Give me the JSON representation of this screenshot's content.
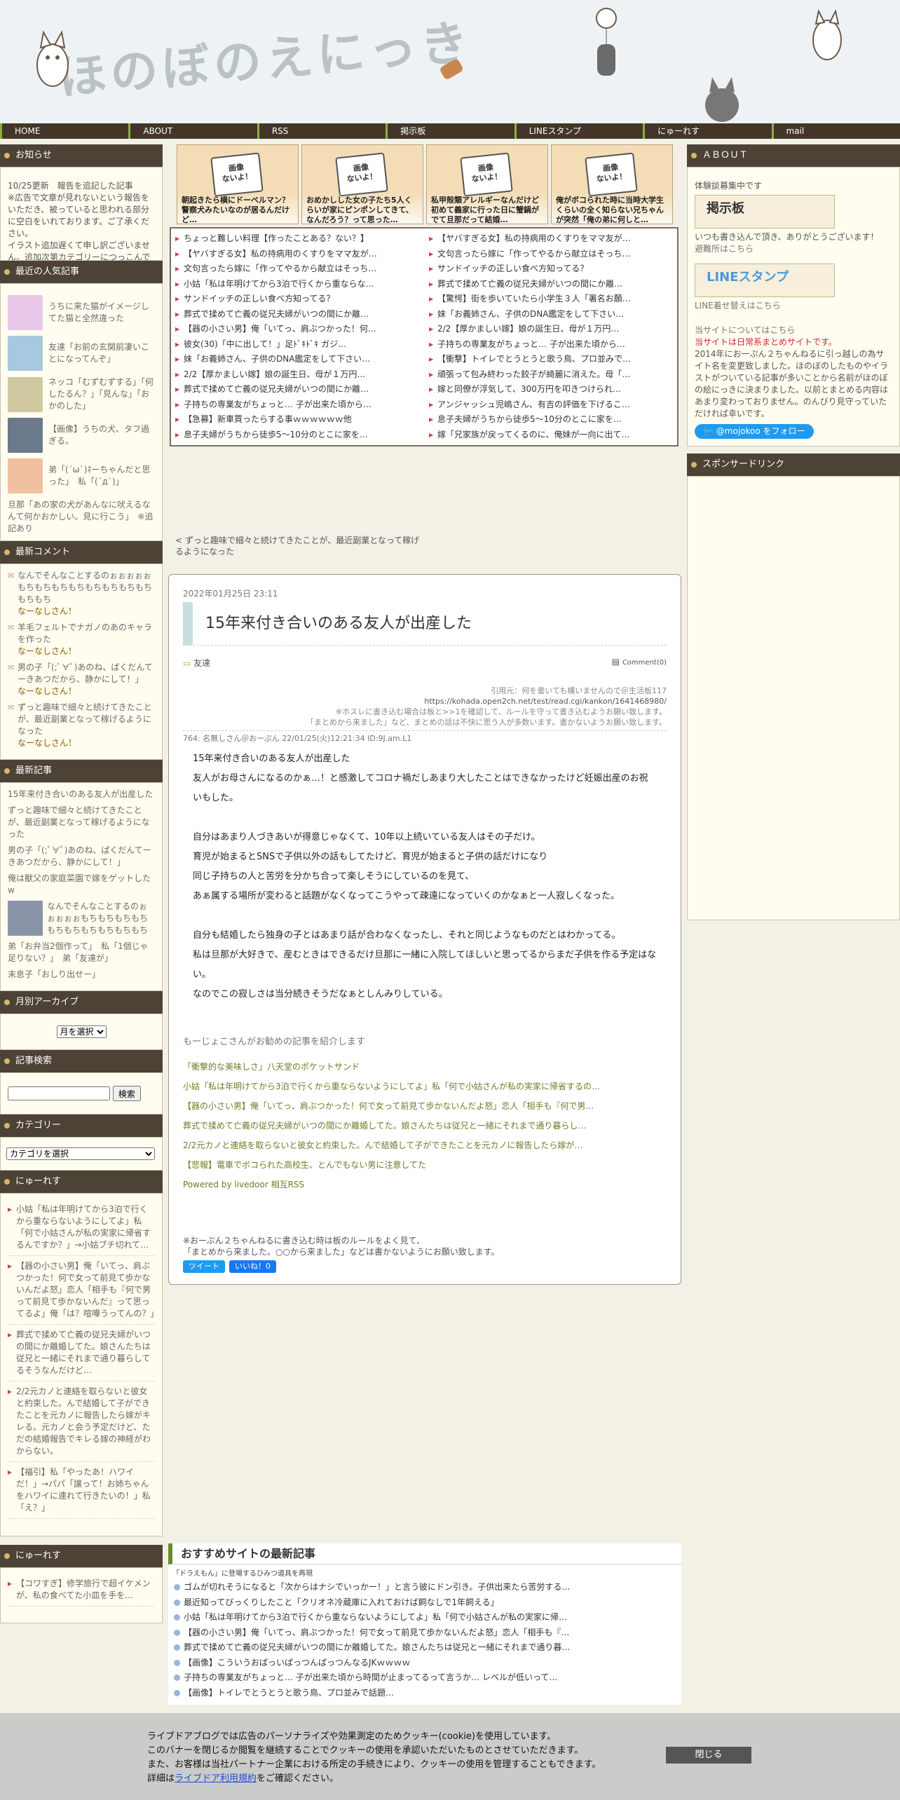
{
  "site": {
    "title": "ほのぼのえにっき"
  },
  "nav": [
    "HOME",
    "ABOUT",
    "RSS",
    "掲示板",
    "LINEスタンプ",
    "にゅーれす",
    "mail"
  ],
  "left": {
    "notice": {
      "title": "お知らせ",
      "body": "10/25更新　報告を追記した記事\n※広告で文章が見れないという報告をいただき、被っていると思われる部分に空白をいれております。ご了承ください。\nイラスト追加遅くて申し訳ございません。追加次第カテゴリーにつっこんでます。"
    },
    "popular": {
      "title": "最近の人気記事",
      "items": [
        {
          "text": "うちに来た猫がイメージしてた猫と全然違った",
          "color": "#e8c8e8"
        },
        {
          "text": "友達「お前の玄関前凄いことになってんぞ」",
          "color": "#a8c8e0"
        },
        {
          "text": "ネッコ「むずむずする」「何したるん？」「見んな」「おかのした」",
          "color": "#d0c8a0"
        },
        {
          "text": "【画像】うちの犬、タフ過ぎる。",
          "color": "#6a7a8a"
        },
        {
          "text": "弟「(´ω`)ﾈーちゃんだと思った」　私「(´д`)」",
          "color": "#f0c0a0"
        }
      ],
      "note": "旦那「あの家の犬があんなに吠えるなんて何かおかしい。見に行こう」　※追記あり"
    },
    "comments": {
      "title": "最新コメント",
      "items": [
        {
          "title": "なんでそんなことするのぉぉぉぉぉもちもちもちもちもちもちもちもちもちもち",
          "author": "なーなしさん！"
        },
        {
          "title": "羊毛フェルトでナガノのあのキャラを作った",
          "author": "なーなしさん！"
        },
        {
          "title": "男の子「(;ﾟ∀ﾟ)あのね、ぱくだんてーきあつだから、静かにして！」",
          "author": "なーなしさん！"
        },
        {
          "title": "ずっと趣味で細々と続けてきたことが、最近副業となって稼げるようになった",
          "author": "なーなしさん！"
        }
      ]
    },
    "recent": {
      "title": "最新記事",
      "items": [
        "15年来付き合いのある友人が出産した",
        "ずっと趣味で細々と続けてきたことが、最近副業となって稼げるようになった",
        "男の子「(;ﾟ∀ﾟ)あのね、ぱくだんてーきあつだから、静かにして！」",
        "俺は獣父の家庭菜園で嫁をゲットしたw",
        "なんでそんなことするのぉぉぉぉぉもちもちもちもちもちもちもちもちもちもち",
        "弟「お弁当2個作って」　私「1個じゃ足りない？」　弟「友達が」",
        "末息子「おしり出せー」"
      ]
    },
    "archive": {
      "title": "月別アーカイブ",
      "select": "月を選択"
    },
    "search": {
      "title": "記事検索",
      "button": "検索",
      "placeholder": ""
    },
    "category": {
      "title": "カテゴリー",
      "select": "カテゴリを選択"
    },
    "news1": {
      "title": "にゅーれす",
      "items": [
        "小姑「私は年明けてから3泊で行くから重ならないようにしてよ」私「何で小姑さんが私の実家に帰省するんですか？」→小姑ブチ切れて…",
        "【器の小さい男】俺「いてっ、肩ぶつかった！何で女って前見て歩かないんだよ怒」恋人「相手も『何で男って前見て歩かないんだ』って思ってるよ」俺「は？喧嘩うってんの？」",
        "葬式で揉めて亡義の従兄夫婦がいつの間にか離婚してた。娘さんたちは従兄と一緒にそれまで通り暮らしてるそうなんだけど…",
        "2/2元カノと連絡を取らないと彼女と約束した。んで結婚して子ができたことを元カノに報告したら嫁がキレる。元カノと会う予定だけど、ただの結婚報告でキレる嫁の神経がわからない。",
        "【福引】私「やったあ！ハワイだ！」→パパ「譲って！お姉ちゃんをハワイに連れて行きたいの！」私「え？」"
      ]
    },
    "news2": {
      "title": "にゅーれす",
      "items": [
        "【コワすぎ】修学旅行で超イケメンが、私の食べてた小皿を手を…"
      ]
    }
  },
  "center": {
    "thumbs": [
      {
        "cap": "朝起きたら横にドーベルマン？警察犬みたいなのが居るんだけど…",
        "noimg": "画像\nないよ！"
      },
      {
        "cap": "おめかしした女の子たち5人くらいが家にピンポンしてきて、なんだろう？って思った…",
        "noimg": "画像\nないよ！"
      },
      {
        "cap": "私甲殻類アレルギーなんだけど初めて義家に行った日に蟹鍋がでて旦那だって結婚…",
        "noimg": "画像\nないよ！"
      },
      {
        "cap": "俺がボコられた時に当時大学生くらいの全く知らない兄ちゃんが突然「俺の弟に何しと…",
        "noimg": "画像\nないよ！"
      }
    ],
    "rss_left": [
      "ちょっと難しい料理【作ったことある？ない？】",
      "【ヤバすぎる女】私の持病用のくすりをママ友が…",
      "文句言ったら嫁に「作ってやるから献立はそっち…",
      "小姑「私は年明けてから3泊で行くから重ならな…",
      "サンドイッチの正しい食べ方知ってる？",
      "葬式で揉めて亡義の従兄夫婦がいつの間にか離…",
      "【器の小さい男】俺「いてっ、肩ぶつかった！何…",
      "彼女(30)「中に出して！」足ﾄﾞｷﾄﾞｷ ガジ…",
      "妹「お義姉さん、子供のDNA鑑定をして下さい…",
      "2/2【厚かましい嫁】娘の誕生日、母が１万円…",
      "葬式で揉めて亡義の従兄夫婦がいつの間にか離…",
      "子持ちの専業友がちょっと… 子が出来た頃から…",
      "【急募】新車買ったらする事ｗｗｗｗｗｗ他",
      "息子夫婦がうちから徒歩5～10分のとこに家を…"
    ],
    "rss_right": [
      "【ヤバすぎる女】私の持病用のくすりをママ友が…",
      "文句言ったら嫁に「作ってやるから献立はそっち…",
      "サンドイッチの正しい食べ方知ってる？",
      "葬式で揉めて亡義の従兄夫婦がいつの間にか離…",
      "【驚愕】街を歩いていたら小学生３人「署名お願…",
      "妹「お義姉さん、子供のDNA鑑定をして下さい…",
      "2/2【厚かましい嫁】娘の誕生日、母が１万円…",
      "子持ちの専業友がちょっと… 子が出来た頃から…",
      "【衝撃】トイレでとうとうと歌う鳥、プロ並みで…",
      "頑張って包み終わった餃子が綺麗に消えた。母「…",
      "嫁と同僚が浮気して、300万円を叩きつけられ…",
      "アンジャッシュ児嶋さん、有吉の評価を下げるこ…",
      "息子夫婦がうちから徒歩5～10分のとこに家を…",
      "嫁「兄家族が戻ってくるのに、俺妹が一向に出て…"
    ],
    "pager": "< ずっと趣味で細々と続けてきたことが、最近副業となって稼げるようになった",
    "article": {
      "date": "2022年01月25日 23:11",
      "title": "15年来付き合いのある友人が出産した",
      "category": "友達",
      "comments": "Comment(0)",
      "quote1": "引用元：何を書いても構いませんので＠生活板117",
      "quote2": "https://kohada.open2ch.net/test/read.cgi/kankon/1641468980/",
      "quote3": "※ホスレに書き込む場合は板と>>1を確認して、ルールを守って書き込むようお願い致します。",
      "quote4": "「まとめから来ました」など、まとめの話は不快に思う人が多数います。書かないようお願い致します。",
      "res": "764: 名無しさん＠おーぷん 22/01/25(火)12:21:34 ID:9J.am.L1",
      "body": [
        "15年来付き合いのある友人が出産した",
        "友人がお母さんになるのかぁ…！と感激してコロナ禍だしあまり大したことはできなかったけど妊娠出産のお祝いもした。",
        "",
        "自分はあまり人づきあいが得意じゃなくて、10年以上続いている友人はその子だけ。",
        "育児が始まるとSNSで子供以外の話もしてたけど、育児が始まると子供の話だけになり",
        "同じ子持ちの人と苦労を分かち合って楽しそうにしているのを見て、",
        "あぁ属する場所が変わると話題がなくなってこうやって疎遠になっていくのかなぁと一人寂しくなった。",
        "",
        "自分も結婚したら独身の子とはあまり話が合わなくなったし、それと同じようなものだとはわかってる。",
        "私は旦那が大好きで、産むときはできるだけ旦那に一緒に入院してほしいと思ってるからまだ子供を作る予定はない。",
        "なのでこの寂しさは当分続きそうだなぁとしんみりしている。"
      ],
      "rec_title": "もーじょこさんがお勧めの記事を紹介します",
      "rec_links": [
        "「衝撃的な美味しさ」八天堂のポケットサンド",
        "小姑「私は年明けてから3泊で行くから重ならないようにしてよ」私「何で小姑さんが私の実家に帰省するの…",
        "【器の小さい男】俺「いてっ、肩ぶつかった！何で女って前見て歩かないんだよ怒」恋人「相手も『何で男…",
        "葬式で揉めて亡義の従兄夫婦がいつの間にか離婚してた。娘さんたちは従兄と一緒にそれまで通り暮らし…",
        "2/2元カノと連絡を取らないと彼女と約束した。んで結婚して子ができたことを元カノに報告したら嫁が…",
        "【悲報】電車でボコられた高校生、とんでもない男に注意してた",
        "Powered by livedoor 相互RSS"
      ],
      "rule1": "※おーぷん２ちゃんねるに書き込む時は板のルールをよく見て、",
      "rule2": "「まとめから来ました。○○から来ました」などは書かないようにお願い致します。",
      "tweet": "ツイート",
      "like": "いいね！0"
    },
    "recsite": {
      "title": "おすすめサイトの最新記事",
      "sub": "「ドラえもん」に登場するひみつ道具を再現",
      "items": [
        "ゴムが切れそうになると「次からはナシでいっかー！」と言う彼にドン引き。子供出来たら苦労する…",
        "最近知ってびっくりしたこと「クリオネ冷蔵庫に入れておけば飼なしで1年飼える」",
        "小姑「私は年明けてから3泊で行くから重ならないようにしてよ」私「何で小姑さんが私の実家に帰…",
        "【器の小さい男】俺「いてっ、肩ぶつかった！何で女って前見て歩かないんだよ怒」恋人「相手も『…",
        "葬式で揉めて亡義の従兄夫婦がいつの間にか離婚してた。娘さんたちは従兄と一緒にそれまで通り暮…",
        "【画像】こういうおぱっいぱっつんぱっつんなるJKｗｗｗｗ",
        "子持ちの専業友がちょっと… 子が出来た頃から時間が止まってるって言うか… レベルが低いって…",
        "【画像】トイレでとうとうと歌う鳥、プロ並みで話題…"
      ]
    }
  },
  "right": {
    "about": {
      "title": "ＡＢＯＵＴ",
      "line1": "体験談募集中です",
      "banner1": "掲示板",
      "line2": "いつも書き込んで頂き、ありがとうございます！",
      "line3": "避難所はこちら",
      "banner2": "LINEスタンプ",
      "line4": "LINE着せ替えはこちら",
      "line5": "当サイトについてはこちら",
      "red": "当サイトは日常系まとめサイトです。",
      "body": "2014年にお一ぷん２ちゃんねるに引っ越しの為サイト名を変更致しました。ほのぼのしたものやイラストがついている記事が多いことから名前がほのぼの絵にっきに決まりました。以前とまとめる内容はあまり変わっておりません。のんびり見守っていただければ幸いです。",
      "twitter": "@mojokoo をフォロー"
    },
    "sponsor": {
      "title": "スポンサードリンク"
    }
  },
  "cookie": {
    "line1": "ライブドアブログでは広告のパーソナライズや効果測定のためクッキー(cookie)を使用しています。",
    "line2": "このバナーを閉じるか閲覧を継続することでクッキーの使用を承認いただいたものとさせていただきます。",
    "line3": "また、お客様は当社パートナー企業における所定の手続きにより、クッキーの使用を管理することもできます。",
    "line4_pre": "詳細は",
    "line4_link": "ライブドア利用規約",
    "line4_post": "をご確認ください。",
    "close": "閉じる"
  }
}
